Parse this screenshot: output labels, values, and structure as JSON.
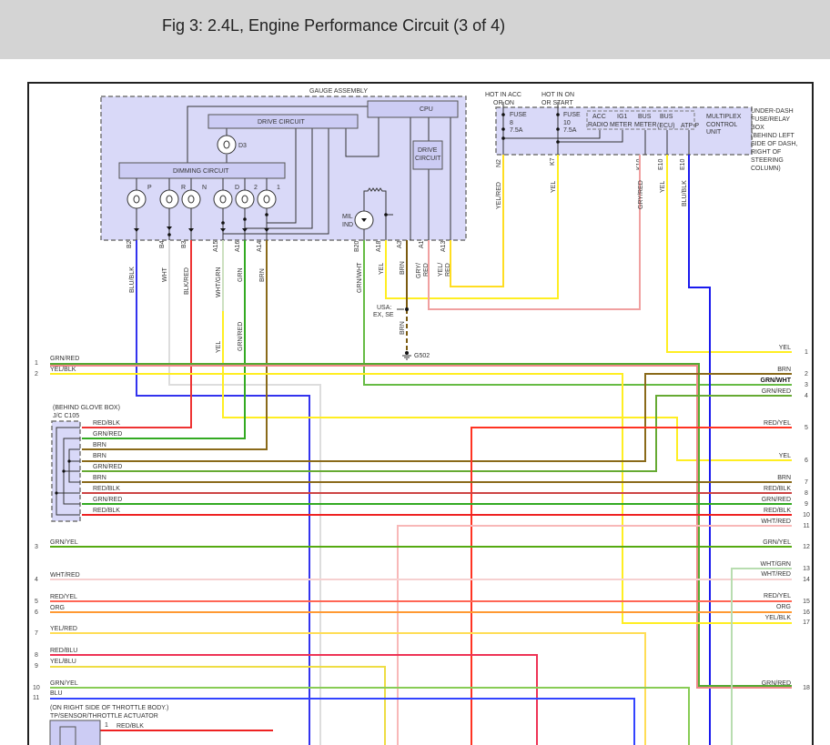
{
  "title": "Fig 3: 2.4L, Engine Performance Circuit (3 of 4)",
  "gauge": {
    "label": "GAUGE ASSEMBLY",
    "cpu": "CPU",
    "drive_circuit": "DRIVE CIRCUIT",
    "dimming_circuit": "DIMMING CIRCUIT",
    "drive_circuit2": [
      "DRIVE",
      "CIRCUIT"
    ],
    "d3": "D3",
    "lamps": [
      "P",
      "R",
      "N",
      "D",
      "2",
      "1"
    ],
    "mil": "MIL",
    "ind": "IND",
    "pins": [
      "B2",
      "B4",
      "B3",
      "A15",
      "A16",
      "A14",
      "B20",
      "A18",
      "A3",
      "A1",
      "A13"
    ],
    "wires": [
      "BLU/BLK",
      "WHT",
      "BLK/RED",
      "WHT/GRN",
      "GRN",
      "BRN",
      "GRN/WHT",
      "YEL",
      "BRN",
      "GRY/",
      "RED",
      "YEL/",
      "RED"
    ],
    "spliced": [
      "YEL",
      "GRN/RED"
    ]
  },
  "ground": {
    "usa": "USA:",
    "variants": "EX, SE",
    "wire": "BRN",
    "name": "G502"
  },
  "fusebox": {
    "hot1": [
      "HOT IN ACC",
      "OR ON"
    ],
    "hot2": [
      "HOT IN ON",
      "OR START"
    ],
    "fuse1": [
      "FUSE",
      "8",
      "7.5A"
    ],
    "fuse2": [
      "FUSE",
      "10",
      "7.5A"
    ],
    "mcu": [
      "ACC",
      "IG1",
      "BUS",
      "BUS",
      "RADIO",
      "METER",
      "METER",
      "(ECU)",
      "ATP-P"
    ],
    "mcu_label": [
      "MULTIPLEX",
      "CONTROL",
      "UNIT"
    ],
    "box_label": [
      "UNDER-DASH",
      "FUSE/RELAY",
      "BOX",
      "(BEHIND LEFT",
      "SIDE OF DASH,",
      "RIGHT OF",
      "STEERING",
      "COLUMN)"
    ],
    "pins": [
      "N2",
      "K7",
      "K10",
      "E10",
      "E10"
    ],
    "wires": [
      "YEL/RED",
      "YEL",
      "GRY/RED",
      "YEL",
      "BLU/BLK"
    ]
  },
  "jc": {
    "title": [
      "(BEHIND GLOVE BOX)",
      "J/C C105"
    ],
    "wires": [
      "RED/BLK",
      "GRN/RED",
      "BRN",
      "BRN",
      "GRN/RED",
      "BRN",
      "RED/BLK",
      "GRN/RED",
      "RED/BLK"
    ]
  },
  "left_rows": [
    {
      "n": "1",
      "label": "GRN/RED"
    },
    {
      "n": "2",
      "label": "YEL/BLK"
    },
    {
      "n": "3",
      "label": "GRN/YEL"
    },
    {
      "n": "4",
      "label": "WHT/RED"
    },
    {
      "n": "5",
      "label": "RED/YEL"
    },
    {
      "n": "6",
      "label": "ORG"
    },
    {
      "n": "7",
      "label": "YEL/RED"
    },
    {
      "n": "8",
      "label": "RED/BLU"
    },
    {
      "n": "9",
      "label": "YEL/BLU"
    },
    {
      "n": "10",
      "label": "GRN/YEL"
    },
    {
      "n": "11",
      "label": "BLU"
    }
  ],
  "right_rows": [
    {
      "n": "1",
      "label": "YEL"
    },
    {
      "n": "2",
      "label": "BRN"
    },
    {
      "n": "3",
      "label": "GRN/WHT"
    },
    {
      "n": "4",
      "label": "GRN/RED"
    },
    {
      "n": "5",
      "label": "RED/YEL"
    },
    {
      "n": "6",
      "label": "YEL"
    },
    {
      "n": "7",
      "label": "BRN"
    },
    {
      "n": "8",
      "label": "RED/BLK"
    },
    {
      "n": "9",
      "label": "GRN/RED"
    },
    {
      "n": "10",
      "label": "RED/BLK"
    },
    {
      "n": "11",
      "label": "WHT/RED"
    },
    {
      "n": "12",
      "label": "GRN/YEL"
    },
    {
      "n": "13",
      "label": "WHT/GRN"
    },
    {
      "n": "14",
      "label": "WHT/RED"
    },
    {
      "n": "15",
      "label": "RED/YEL"
    },
    {
      "n": "16",
      "label": "ORG"
    },
    {
      "n": "17",
      "label": "YEL/BLK"
    },
    {
      "n": "18",
      "label": "GRN/RED"
    }
  ],
  "throttle": {
    "title": [
      "(ON RIGHT SIDE OF THROTTLE BODY.)",
      "TP/SENSOR/THROTTLE ACTUATOR"
    ],
    "pin": "1",
    "wire": "RED/BLK"
  }
}
